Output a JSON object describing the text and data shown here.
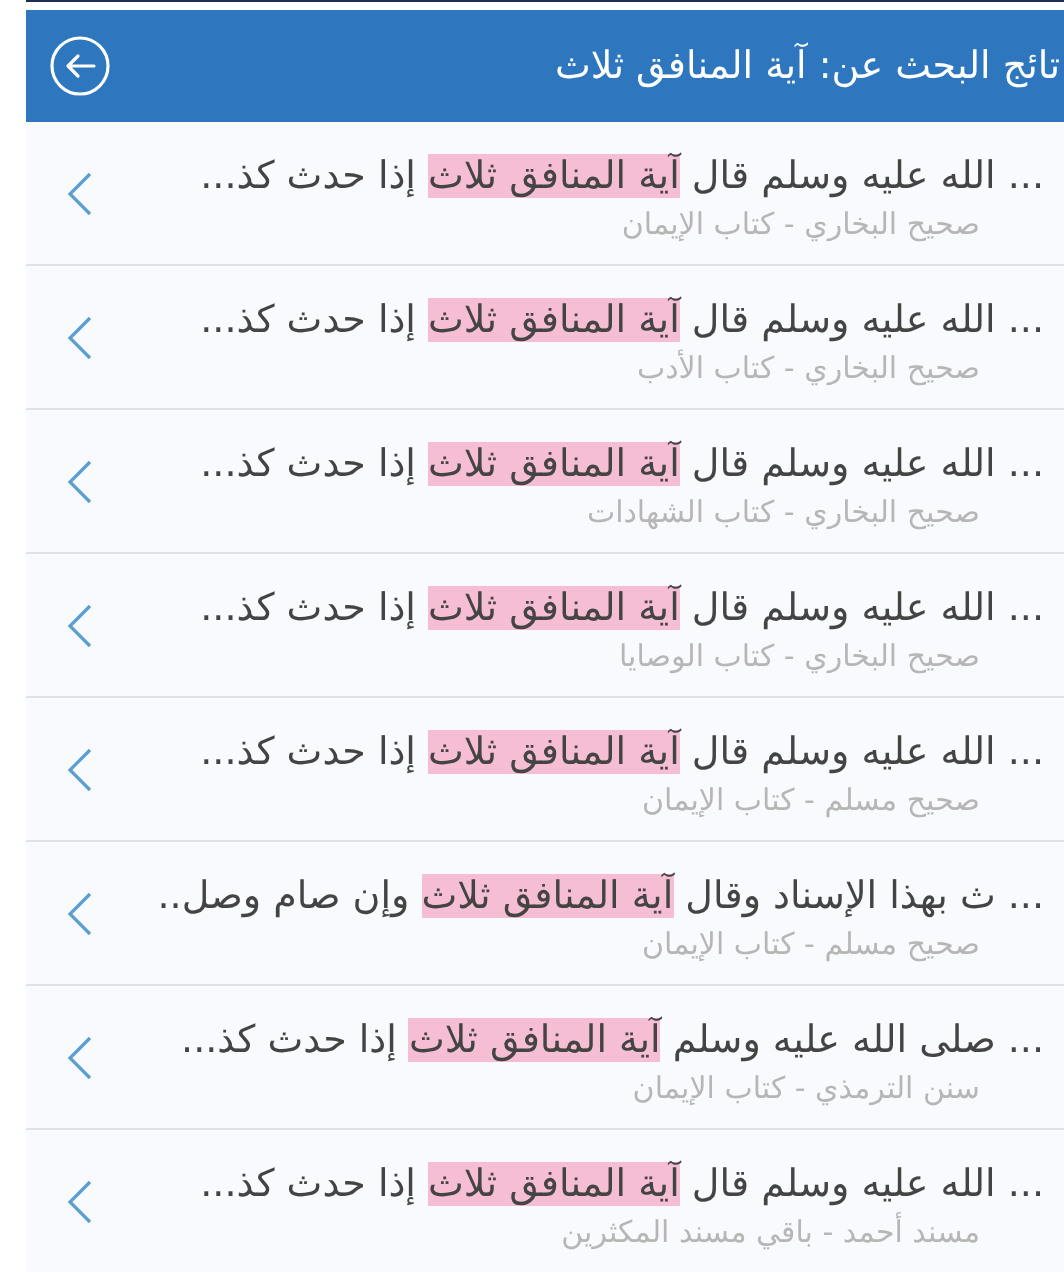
{
  "header": {
    "title": "تائج البحث عن: آية المنافق ثلاث"
  },
  "results": [
    {
      "before": "... الله عليه وسلم قال ",
      "match": "آية المنافق ثلاث",
      "after": " إذا حدث كذ...",
      "source": "صحيح البخاري - كتاب الإيمان"
    },
    {
      "before": "... الله عليه وسلم قال ",
      "match": "آية المنافق ثلاث",
      "after": " إذا حدث كذ...",
      "source": "صحيح البخاري - كتاب الأدب"
    },
    {
      "before": "... الله عليه وسلم قال ",
      "match": "آية المنافق ثلاث",
      "after": " إذا حدث كذ...",
      "source": "صحيح البخاري - كتاب الشهادات"
    },
    {
      "before": "... الله عليه وسلم قال ",
      "match": "آية المنافق ثلاث",
      "after": " إذا حدث كذ...",
      "source": "صحيح البخاري - كتاب الوصايا"
    },
    {
      "before": "... الله عليه وسلم قال ",
      "match": "آية المنافق ثلاث",
      "after": " إذا حدث كذ...",
      "source": "صحيح مسلم - كتاب الإيمان"
    },
    {
      "before": "... ث بهذا الإسناد وقال ",
      "match": "آية المنافق ثلاث",
      "after": " وإن صام وصل..",
      "source": "صحيح مسلم - كتاب الإيمان"
    },
    {
      "before": "... صلى الله عليه وسلم ",
      "match": "آية المنافق ثلاث",
      "after": " إذا حدث كذ...",
      "source": "سنن الترمذي - كتاب الإيمان"
    },
    {
      "before": "... الله عليه وسلم قال ",
      "match": "آية المنافق ثلاث",
      "after": " إذا حدث كذ...",
      "source": "مسند أحمد - باقي مسند المكثرين"
    }
  ]
}
